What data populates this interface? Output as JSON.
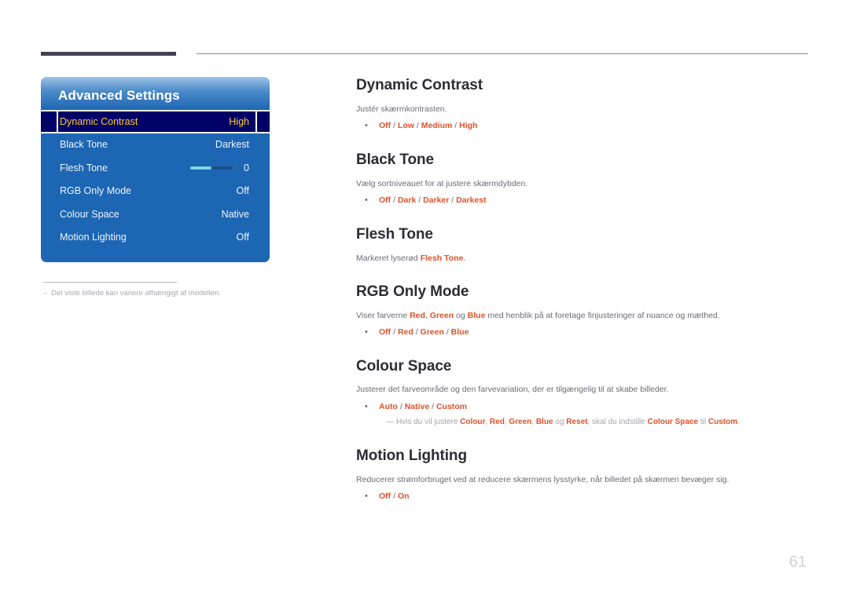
{
  "page": {
    "number": "61",
    "footnote_dash": "–",
    "footnote_text": "Det viste billede kan variere afhængigt af modellen."
  },
  "osd": {
    "title": "Advanced Settings",
    "rows": [
      {
        "label": "Dynamic Contrast",
        "value": "High",
        "selected": true,
        "slider": false
      },
      {
        "label": "Black Tone",
        "value": "Darkest",
        "selected": false,
        "slider": false
      },
      {
        "label": "Flesh Tone",
        "value": "0",
        "selected": false,
        "slider": true,
        "slider_percent": 50
      },
      {
        "label": "RGB Only Mode",
        "value": "Off",
        "selected": false,
        "slider": false
      },
      {
        "label": "Colour Space",
        "value": "Native",
        "selected": false,
        "slider": false
      },
      {
        "label": "Motion Lighting",
        "value": "Off",
        "selected": false,
        "slider": false
      }
    ],
    "colors": {
      "panel_blue": "#1c66b4",
      "highlight_navy": "#000066",
      "highlight_text": "#ffcc33",
      "slider_fill": "#7fd3e0",
      "slider_track": "#1b4f86"
    }
  },
  "doc": {
    "accent_color": "#e0512a",
    "sections": [
      {
        "heading": "Dynamic Contrast",
        "description": "Justér skærmkontrasten.",
        "bullet_dot": "•",
        "options": [
          "Off",
          "Low",
          "Medium",
          "High"
        ]
      },
      {
        "heading": "Black Tone",
        "description": "Vælg sortniveauet for at justere skærmdybden.",
        "bullet_dot": "•",
        "options": [
          "Off",
          "Dark",
          "Darker",
          "Darkest"
        ]
      },
      {
        "heading": "Flesh Tone",
        "description_pre": "Markeret lyserød ",
        "description_hl": "Flesh Tone",
        "description_post": "."
      },
      {
        "heading": "RGB Only Mode",
        "desc_part1": "Viser farverne ",
        "desc_hl1": "Red",
        "desc_part2": ", ",
        "desc_hl2": "Green",
        "desc_part3": " og ",
        "desc_hl3": "Blue",
        "desc_part4": " med henblik på at foretage finjusteringer af nuance og mæthed.",
        "bullet_dot": "•",
        "options": [
          "Off",
          "Red",
          "Green",
          "Blue"
        ]
      },
      {
        "heading": "Colour Space",
        "description": "Justerer det farveområde og den farvevariation, der er tilgængelig til at skabe billeder.",
        "bullet_dot": "•",
        "options": [
          "Auto",
          "Native",
          "Custom"
        ],
        "subnote": {
          "dash": "—",
          "p1": "Hvis du vil justere ",
          "b1": "Colour",
          "p2": ", ",
          "b2": "Red",
          "p3": ", ",
          "b3": "Green",
          "p4": ", ",
          "b4": "Blue",
          "p5": " og ",
          "b5": "Reset",
          "p6": ", skal du indstille ",
          "b6": "Colour Space",
          "p7": " til ",
          "b7": "Custom",
          "p8": "."
        }
      },
      {
        "heading": "Motion Lighting",
        "description": "Reducerer strømforbruget ved at reducere skærmens lysstyrke, når billedet på skærmen bevæger sig.",
        "bullet_dot": "•",
        "options": [
          "Off",
          "On"
        ]
      }
    ]
  }
}
